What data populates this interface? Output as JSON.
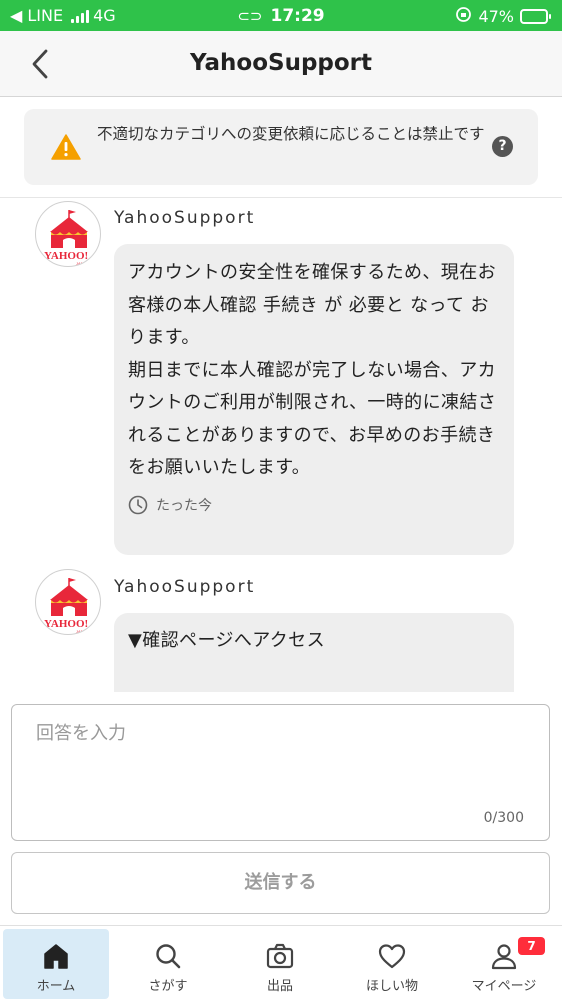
{
  "status_bar": {
    "carrier": "◀ LINE",
    "network": "4G",
    "time": "17:29",
    "battery": "47%"
  },
  "header": {
    "title": "YahooSupport",
    "back_icon": "chevron-left-icon"
  },
  "warning": {
    "icon": "warning-icon",
    "text": "不適切なカテゴリへの変更依頼に応じることは禁止です",
    "help_icon": "?"
  },
  "messages": [
    {
      "sender": "YahooSupport",
      "text": "アカウントの安全性を確保するため、現在お客様の本人確認 手続き が 必要と なって おります。\n期日までに本人確認が完了しない場合、アカウントのご利用が制限され、一時的に凍結されることがありますので、お早めのお手続きをお願いいたします。",
      "time": "たった今"
    },
    {
      "sender": "YahooSupport",
      "text": "▼確認ページへアクセス"
    }
  ],
  "composer": {
    "placeholder": "回答を入力",
    "value": "",
    "counter": "0/300",
    "send_label": "送信する"
  },
  "tabs": [
    {
      "label": "ホーム",
      "icon": "home-icon",
      "active": true
    },
    {
      "label": "さがす",
      "icon": "search-icon",
      "active": false
    },
    {
      "label": "出品",
      "icon": "camera-icon",
      "active": false
    },
    {
      "label": "ほしい物",
      "icon": "heart-icon",
      "active": false
    },
    {
      "label": "マイページ",
      "icon": "person-icon",
      "active": false,
      "badge": "7"
    }
  ],
  "colors": {
    "status_bar": "#2fc24a",
    "warning": "#f5a000",
    "badge": "#ff2d3b",
    "active_tab": "#d9ebf7",
    "logo_red": "#e8273a"
  }
}
